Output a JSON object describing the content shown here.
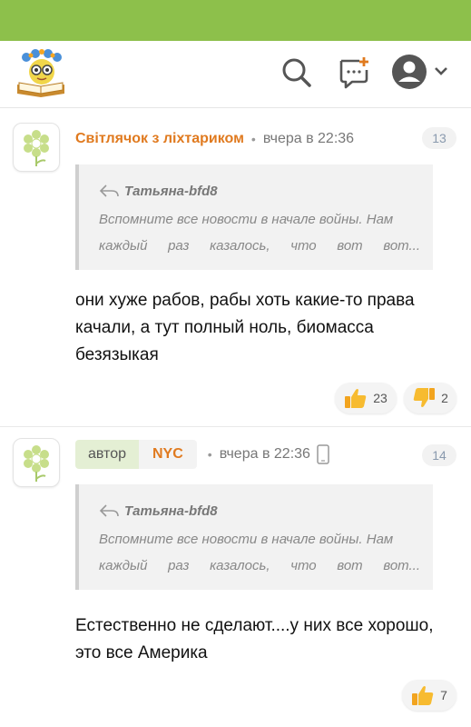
{
  "colors": {
    "brand_green": "#8dc04b",
    "username_orange": "#e07a1f"
  },
  "header": {
    "icons": [
      "book-logo",
      "search-icon",
      "new-post-icon",
      "user-avatar-icon",
      "chevron-down-icon"
    ]
  },
  "comments": [
    {
      "username": "Світлячок з ліхтариком",
      "time": "вчера в 22:36",
      "number": "13",
      "quote_author": "Татьяна-bfd8",
      "quote_line1": "Вспомните все новости в начале войны. Нам",
      "quote_line2_words": [
        "каждый",
        "раз",
        "казалось,",
        "что",
        "вот",
        "вот..."
      ],
      "text": "они хуже рабов, рабы хоть какие-то права качали, а тут полный ноль, биомасса безязыкая",
      "likes": "23",
      "dislikes": "2"
    },
    {
      "author_badge": "автор",
      "username": "NYC",
      "time": "вчера в 22:36",
      "number": "14",
      "quote_author": "Татьяна-bfd8",
      "quote_line1": "Вспомните все новости в начале войны. Нам",
      "quote_line2_words": [
        "каждый",
        "раз",
        "казалось,",
        "что",
        "вот",
        "вот..."
      ],
      "text": "Естественно не сделают....у них все хорошо, это все Америка",
      "likes": "7"
    }
  ]
}
